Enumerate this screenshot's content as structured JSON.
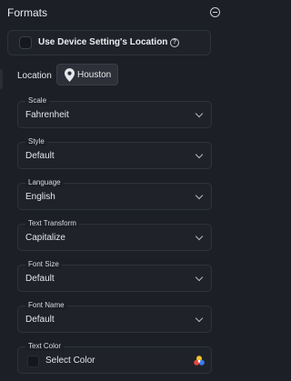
{
  "header": {
    "title": "Formats"
  },
  "device": {
    "label": "Use Device Setting's Location",
    "help_glyph": "?"
  },
  "location": {
    "label": "Location",
    "value": "Houston"
  },
  "fields": [
    {
      "label": "Scale",
      "value": "Fahrenheit"
    },
    {
      "label": "Style",
      "value": "Default"
    },
    {
      "label": "Language",
      "value": "English"
    },
    {
      "label": "Text Transform",
      "value": "Capitalize"
    },
    {
      "label": "Font Size",
      "value": "Default"
    },
    {
      "label": "Font Name",
      "value": "Default"
    }
  ],
  "text_color": {
    "label": "Text Color",
    "value": "Select Color"
  },
  "colors": {
    "background": "#1c1f26",
    "field_border": "#2f333b",
    "chip": "#2d3038"
  }
}
